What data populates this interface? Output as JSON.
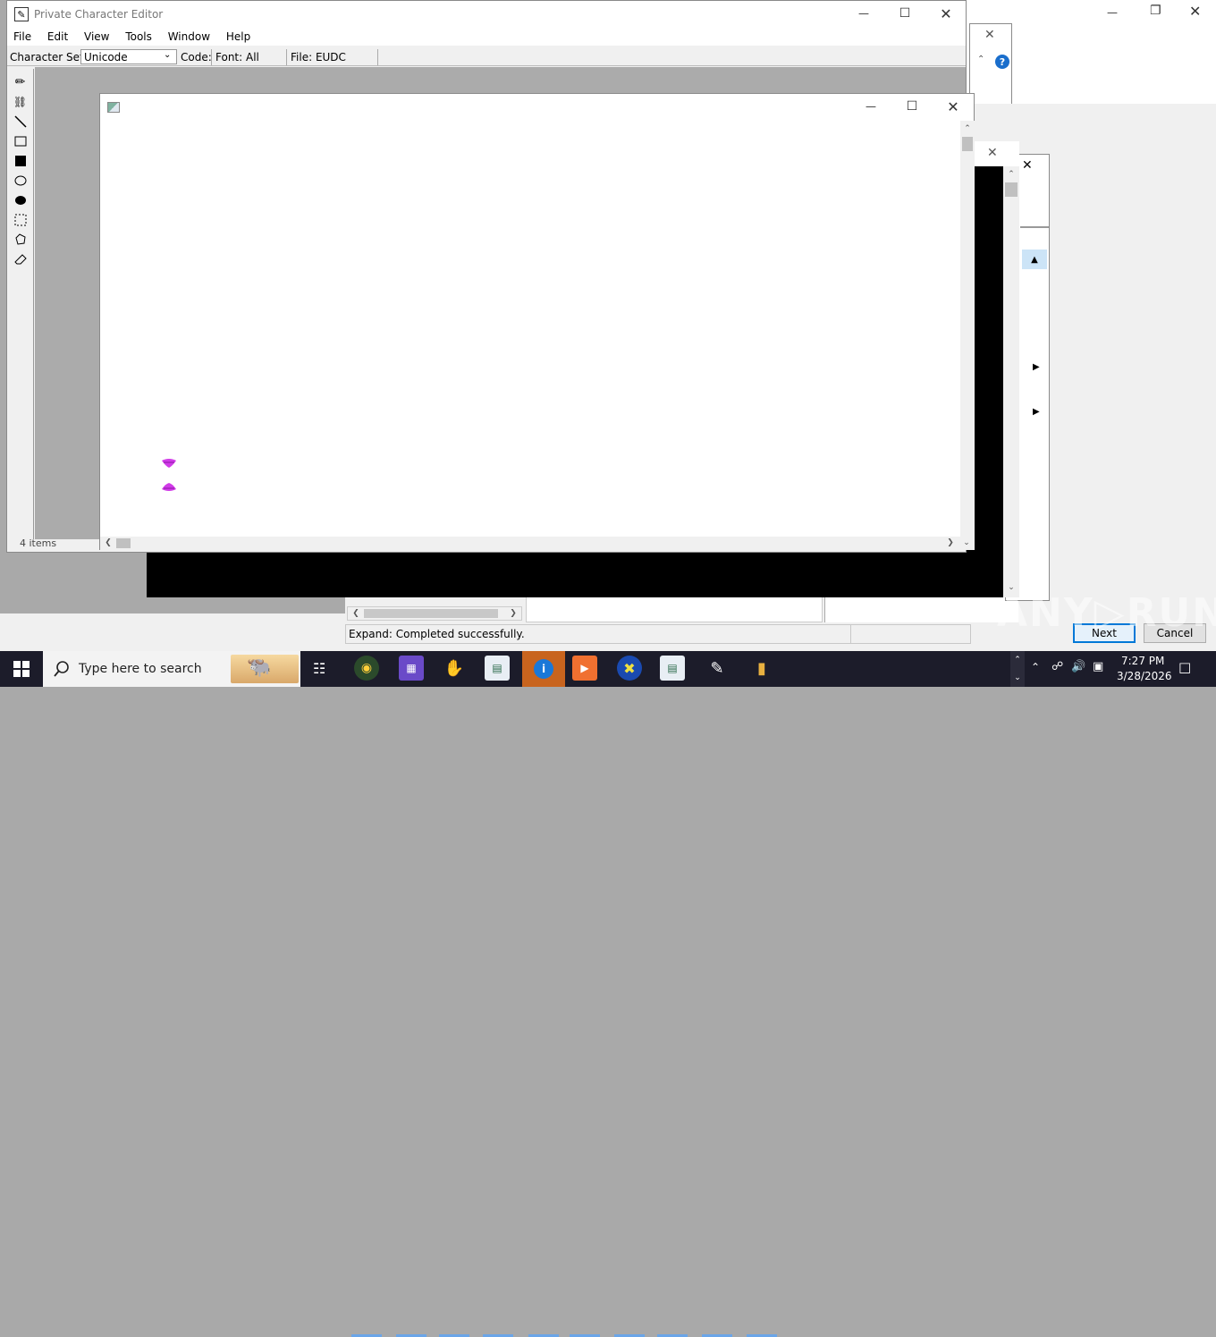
{
  "main_window": {
    "title": "Private Character Editor",
    "menu": [
      "File",
      "Edit",
      "View",
      "Tools",
      "Window",
      "Help"
    ],
    "toolbar": {
      "charset_label": "Character Set:",
      "charset_value": "Unicode",
      "code_label": "Code:",
      "font_label": "Font: All",
      "file_label": "File: EUDC"
    },
    "tools": [
      "pencil-icon",
      "brush-icon",
      "line-icon",
      "rectangle-outline-icon",
      "rectangle-filled-icon",
      "ellipse-outline-icon",
      "ellipse-filled-icon",
      "rect-select-icon",
      "freeform-select-icon",
      "eraser-icon"
    ],
    "status_items": "4 items"
  },
  "background_window": {
    "status": "Expand:  Completed successfully.",
    "next_button": "Next",
    "cancel_button": "Cancel"
  },
  "taskbar": {
    "search_placeholder": "Type here to search",
    "time": "7:27 PM",
    "date": "3/28/2026"
  },
  "colors": {
    "taskbar": "#1c1c2a",
    "accent": "#0078d7",
    "canvas_glyph": "#d13be8"
  }
}
